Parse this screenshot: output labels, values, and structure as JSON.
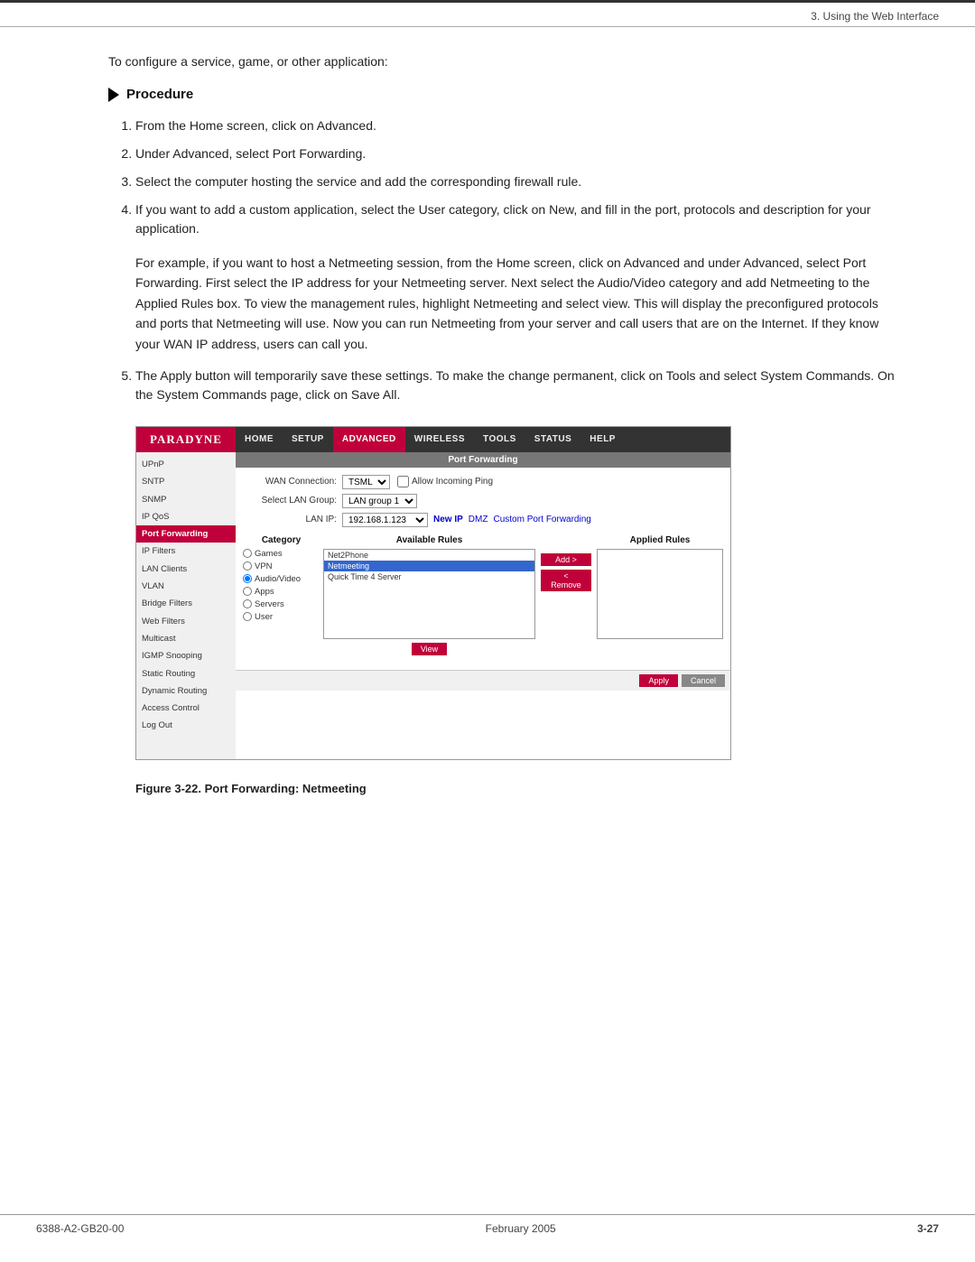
{
  "header": {
    "section": "3. Using the Web Interface"
  },
  "intro": {
    "text": "To configure a service, game, or other application:"
  },
  "procedure": {
    "title": "Procedure",
    "steps": [
      "From the Home screen, click on Advanced.",
      "Under Advanced, select Port Forwarding.",
      "Select the computer hosting the service and add the corresponding firewall rule.",
      "If you want to add a custom application, select the User category, click on New, and fill in the port, protocols and description for your application."
    ],
    "paragraph": "For example, if you want to host a Netmeeting session, from the Home screen, click on Advanced and under Advanced, select Port Forwarding. First select the IP address for your Netmeeting server. Next select the Audio/Video category and add Netmeeting to the Applied Rules box. To view the management rules, highlight Netmeeting and select view. This will display the preconfigured protocols and ports that Netmeeting will use.  Now you can run Netmeeting from your server and call users that are on the Internet. If they know your WAN IP address, users can call you.",
    "step5": "The Apply button will temporarily save these settings. To make the change permanent, click on Tools and select System Commands. On the System Commands page, click on Save All."
  },
  "nav": {
    "logo": "PARADYNE",
    "items": [
      {
        "label": "Home",
        "active": false
      },
      {
        "label": "Setup",
        "active": false
      },
      {
        "label": "Advanced",
        "active": true
      },
      {
        "label": "Wireless",
        "active": false
      },
      {
        "label": "Tools",
        "active": false
      },
      {
        "label": "Status",
        "active": false
      },
      {
        "label": "Help",
        "active": false
      }
    ]
  },
  "sidebar": {
    "items": [
      {
        "label": "UPnP",
        "active": false
      },
      {
        "label": "SNTP",
        "active": false
      },
      {
        "label": "SNMP",
        "active": false
      },
      {
        "label": "IP QoS",
        "active": false
      },
      {
        "label": "Port Forwarding",
        "active": true
      },
      {
        "label": "IP Filters",
        "active": false
      },
      {
        "label": "LAN Clients",
        "active": false
      },
      {
        "label": "VLAN",
        "active": false
      },
      {
        "label": "Bridge Filters",
        "active": false
      },
      {
        "label": "Web Filters",
        "active": false
      },
      {
        "label": "Multicast",
        "active": false
      },
      {
        "label": "IGMP Snooping",
        "active": false
      },
      {
        "label": "Static Routing",
        "active": false
      },
      {
        "label": "Dynamic Routing",
        "active": false
      },
      {
        "label": "Access Control",
        "active": false
      },
      {
        "label": "Log Out",
        "active": false
      }
    ]
  },
  "panel": {
    "title": "Port Forwarding",
    "wan_connection_label": "WAN Connection:",
    "wan_connection_value": "TSML",
    "allow_incoming_ping": "Allow Incoming Ping",
    "select_lan_group_label": "Select LAN Group:",
    "select_lan_group_value": "LAN group 1",
    "lan_ip_label": "LAN IP:",
    "lan_ip_value": "192.168.1.123",
    "new_ip": "New IP",
    "dmz": "DMZ",
    "custom_port_forwarding": "Custom Port Forwarding",
    "category_header": "Category",
    "available_rules_header": "Available Rules",
    "applied_rules_header": "Applied Rules",
    "categories": [
      {
        "label": "Games",
        "selected": false
      },
      {
        "label": "VPN",
        "selected": false
      },
      {
        "label": "Audio/Video",
        "selected": true
      },
      {
        "label": "Apps",
        "selected": false
      },
      {
        "label": "Servers",
        "selected": false
      },
      {
        "label": "User",
        "selected": false
      }
    ],
    "available_rules": [
      {
        "label": "Net2Phone",
        "selected": false
      },
      {
        "label": "Netmeeting",
        "selected": true
      },
      {
        "label": "Quick Time 4 Server",
        "selected": false
      }
    ],
    "add_btn": "Add >",
    "remove_btn": "< Remove",
    "view_btn": "View",
    "apply_btn": "Apply",
    "cancel_btn": "Cancel"
  },
  "figure_caption": "Figure 3-22.   Port Forwarding: Netmeeting",
  "footer": {
    "left": "6388-A2-GB20-00",
    "center": "February 2005",
    "right": "3-27"
  }
}
